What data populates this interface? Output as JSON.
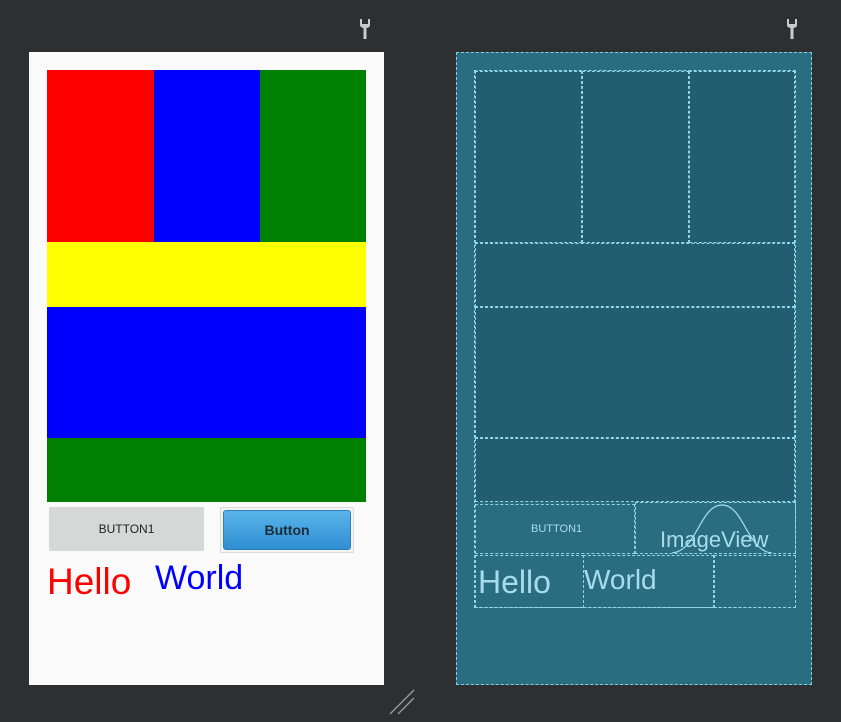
{
  "design": {
    "colors": {
      "red": "#ff0000",
      "blue": "#0000ff",
      "green": "#008000",
      "yellow": "#ffff00"
    },
    "button1_label": "BUTTON1",
    "button2_label": "Button",
    "hello_text": "Hello",
    "world_text": "World"
  },
  "blueprint": {
    "button1_label": "BUTTON1",
    "imageview_label": "ImageView",
    "hello_text": "Hello",
    "world_text": "World"
  },
  "icons": [
    "wrench-icon",
    "resize-handle-icon"
  ]
}
